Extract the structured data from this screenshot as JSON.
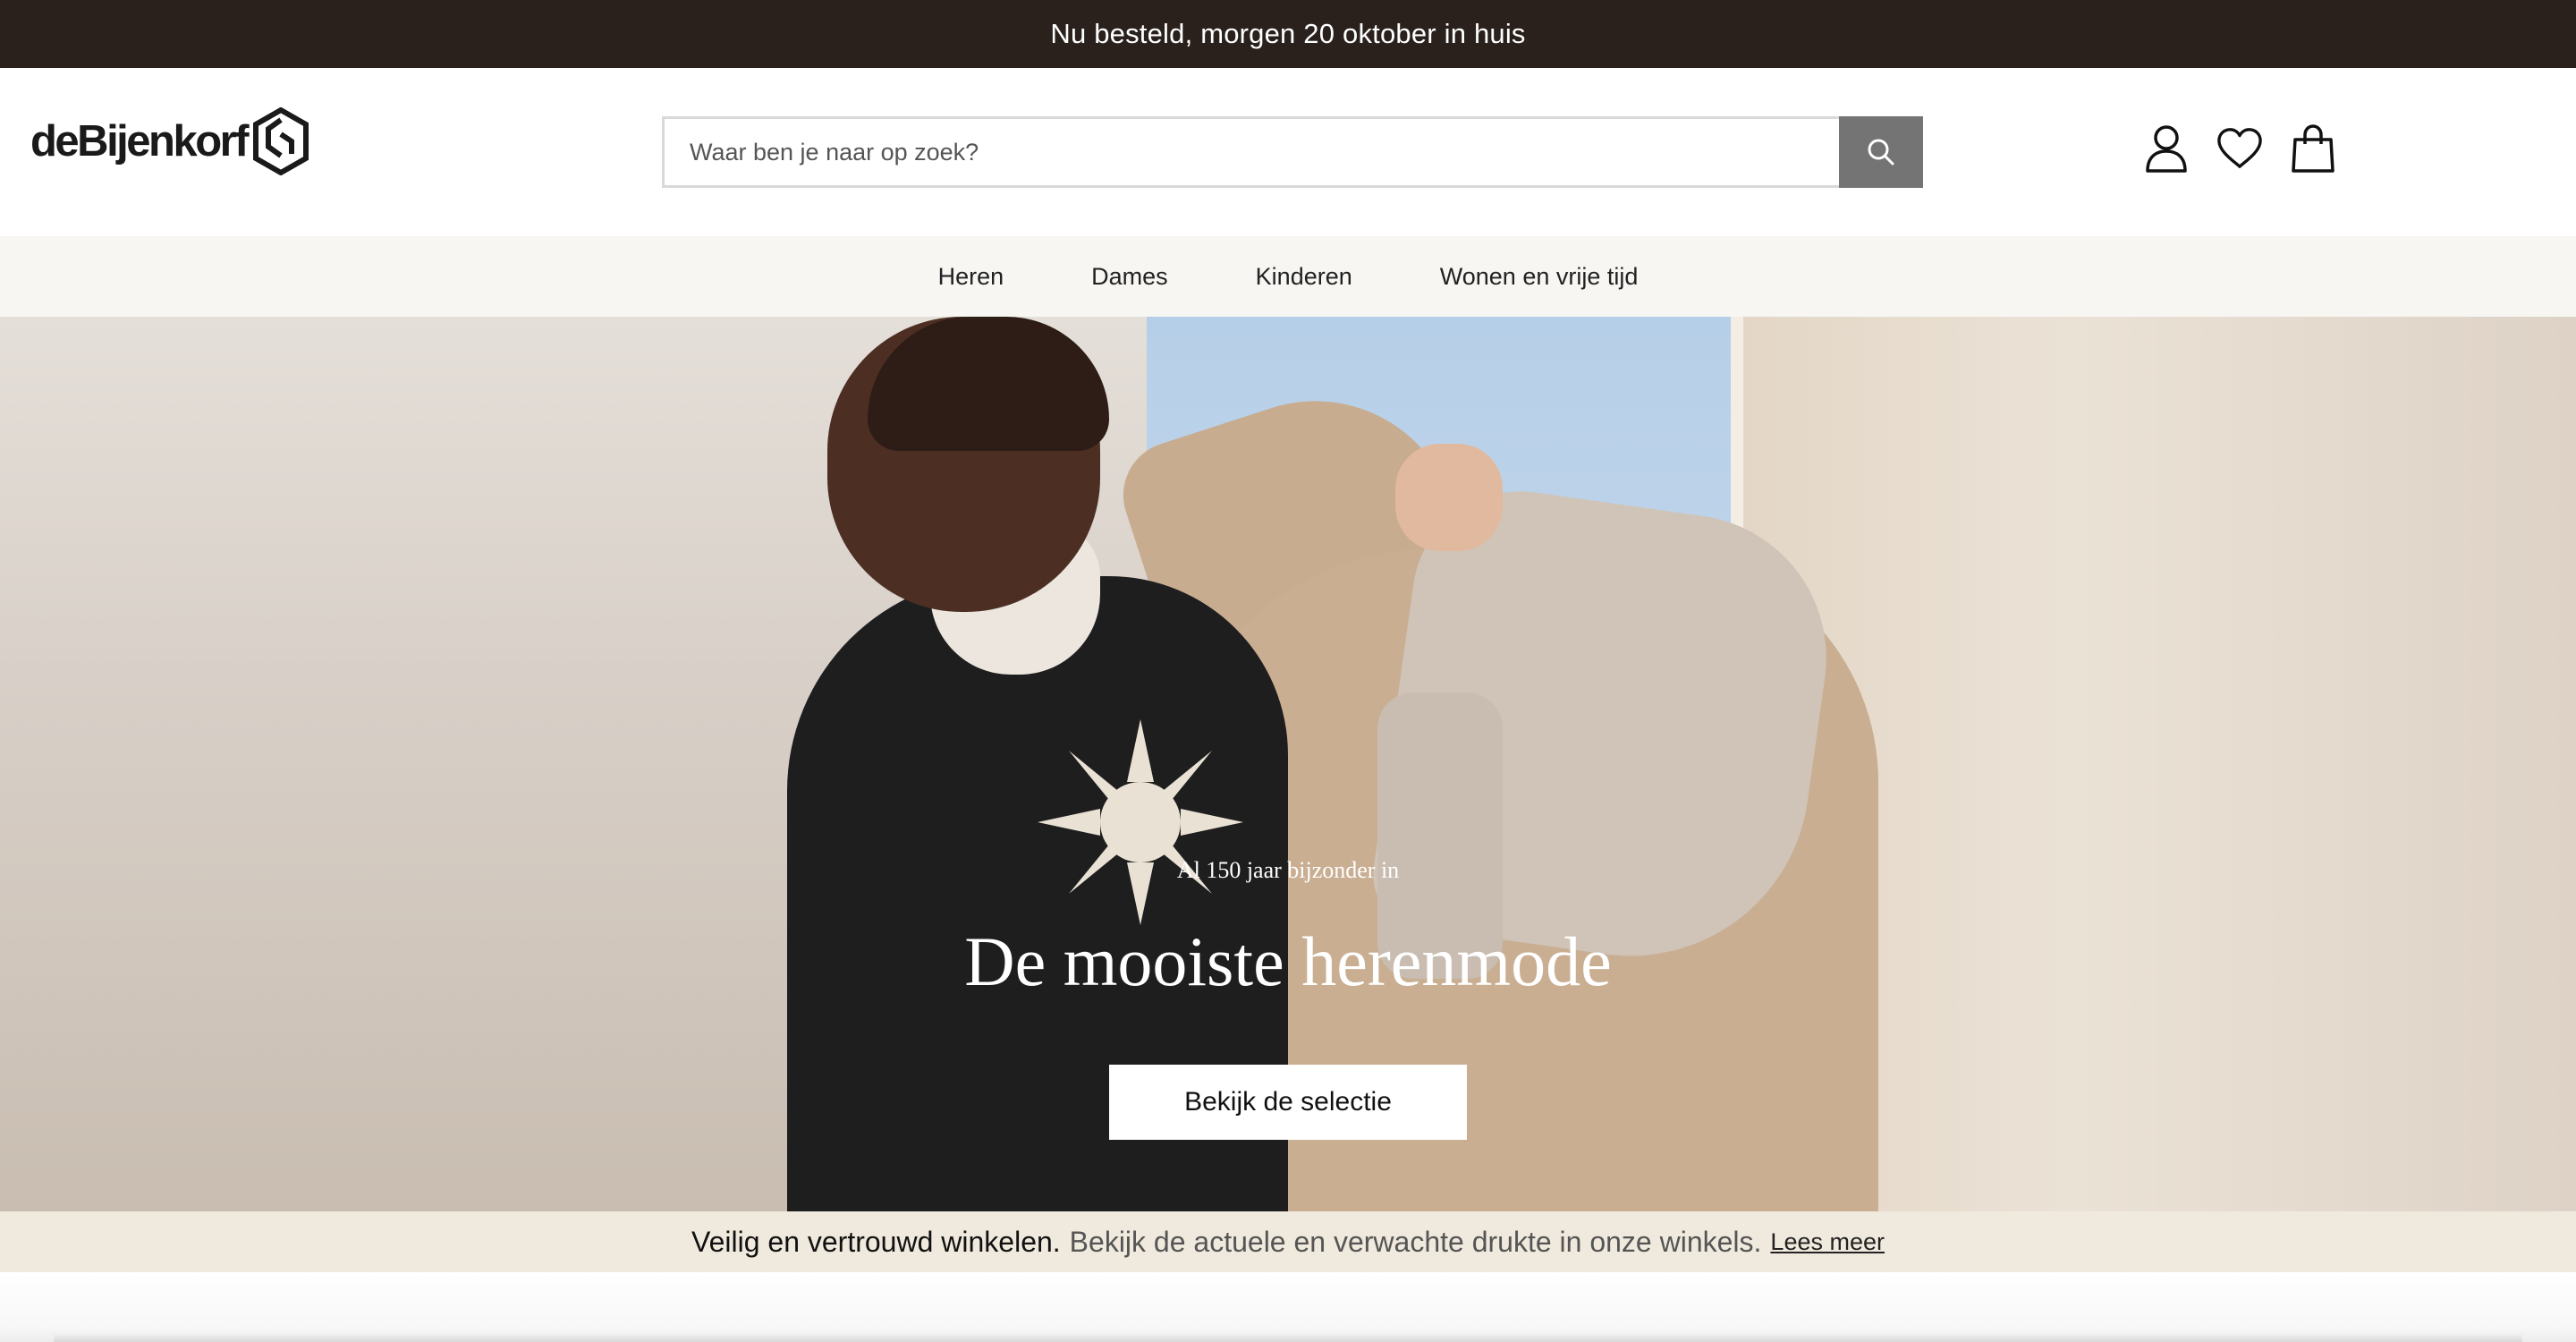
{
  "promo": {
    "text": "Nu besteld, morgen 20 oktober in huis"
  },
  "header": {
    "logo_text": "deBijenkorf",
    "search": {
      "placeholder": "Waar ben je naar op zoek?"
    },
    "icons": [
      "user-icon",
      "heart-icon",
      "shopping-bag-icon"
    ]
  },
  "nav": {
    "items": [
      {
        "label": "Heren"
      },
      {
        "label": "Dames"
      },
      {
        "label": "Kinderen"
      },
      {
        "label": "Wonen en vrije tijd"
      }
    ]
  },
  "hero": {
    "subtitle": "Al 150 jaar bijzonder in",
    "title": "De mooiste herenmode",
    "cta": "Bekijk de selectie"
  },
  "notice": {
    "strong": "Veilig en vertrouwd winkelen.",
    "text": "Bekijk de actuele en verwachte drukte in onze winkels.",
    "link": "Lees meer"
  },
  "colors": {
    "promo_bg": "#2a211d",
    "search_button": "#747474",
    "nav_bg": "#f7f6f3",
    "notice_bg": "#f0e9dd"
  }
}
